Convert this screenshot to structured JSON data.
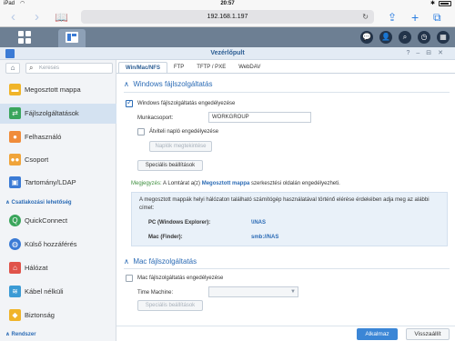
{
  "statusbar": {
    "carrier": "iPad",
    "time": "20:57",
    "battery_icon": "battery-icon"
  },
  "browser": {
    "url": "192.168.1.197"
  },
  "window": {
    "title": "Vezérlőpult"
  },
  "sidebar": {
    "search_placeholder": "Keresés",
    "items": [
      {
        "label": "Megosztott mappa",
        "icon": "folder-icon",
        "color": "#f0b429"
      },
      {
        "label": "Fájlszolgáltatások",
        "icon": "file-services-icon",
        "color": "#3aa55c",
        "active": true
      },
      {
        "label": "Felhasználó",
        "icon": "user-icon",
        "color": "#f08c3a"
      },
      {
        "label": "Csoport",
        "icon": "group-icon",
        "color": "#f0a43a"
      },
      {
        "label": "Tartomány/LDAP",
        "icon": "domain-icon",
        "color": "#3b7bd5"
      }
    ],
    "section_connectivity": "Csatlakozási lehetőség",
    "items2": [
      {
        "label": "QuickConnect",
        "icon": "quickconnect-icon",
        "color": "#3aa55c"
      },
      {
        "label": "Külső hozzáférés",
        "icon": "globe-icon",
        "color": "#3b7bd5"
      },
      {
        "label": "Hálózat",
        "icon": "network-icon",
        "color": "#e0534a"
      },
      {
        "label": "Kábel nélküli",
        "icon": "wifi-icon",
        "color": "#3b9bd5"
      },
      {
        "label": "Biztonság",
        "icon": "shield-icon",
        "color": "#f0b429"
      }
    ],
    "section_system": "Rendszer"
  },
  "tabs": [
    "Win/Mac/NFS",
    "FTP",
    "TFTP / PXE",
    "WebDAV"
  ],
  "windows": {
    "heading": "Windows fájlszolgáltatás",
    "enable_label": "Windows fájlszolgáltatás engedélyezése",
    "workgroup_label": "Munkacsoport:",
    "workgroup_value": "WORKGROUP",
    "log_label": "Átviteli napló engedélyezése",
    "log_button": "Naplók megtekintése",
    "special_button": "Speciális beállítások",
    "note_prefix": "Megjegyzés:",
    "note_mid": " A Lomtárat a(z) ",
    "note_link": "Megosztott mappa",
    "note_suffix": " szerkesztési oldalán engedélyezheti.",
    "info_text": "A megosztott mappák helyi hálózaton található számítógép használatával történő elérése érdekében adja meg az alábbi címet:",
    "pc_label": "PC (Windows Explorer):",
    "pc_value": "\\\\NAS",
    "mac_label": "Mac (Finder):",
    "mac_value": "smb://NAS"
  },
  "mac": {
    "heading": "Mac fájlszolgáltatás",
    "enable_label": "Mac fájlszolgáltatás engedélyezése",
    "timemachine_label": "Time Machine:",
    "timemachine_value": "",
    "special_button": "Speciális beállítások"
  },
  "footer": {
    "apply": "Alkalmaz",
    "revert": "Visszaállít"
  }
}
